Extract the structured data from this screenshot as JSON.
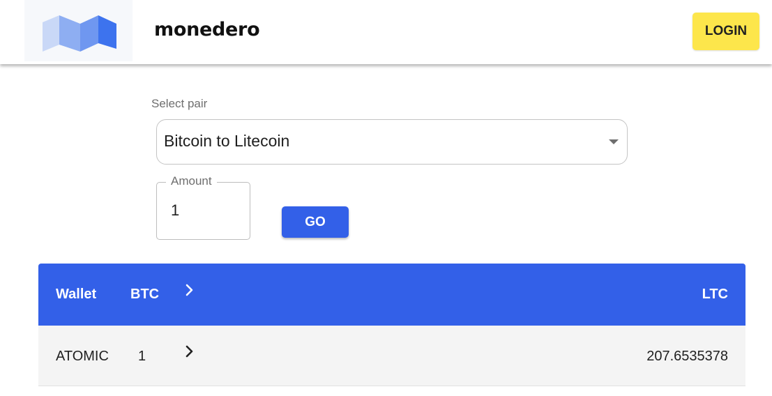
{
  "header": {
    "brand": "monedero",
    "login_label": "LOGIN",
    "logo_icon": "monedero-logo-icon"
  },
  "form": {
    "select_label": "Select pair",
    "pair_value": "Bitcoin to Litecoin",
    "amount_label": "Amount",
    "amount_value": "1",
    "go_label": "GO"
  },
  "table": {
    "headers": {
      "wallet": "Wallet",
      "from": "BTC",
      "to": "LTC"
    },
    "rows": [
      {
        "wallet": "ATOMIC",
        "from": "1",
        "to": "207.6535378"
      }
    ]
  },
  "colors": {
    "accent": "#3360e8",
    "login_bg": "#fde64b",
    "row_bg": "#f4f4f4"
  }
}
